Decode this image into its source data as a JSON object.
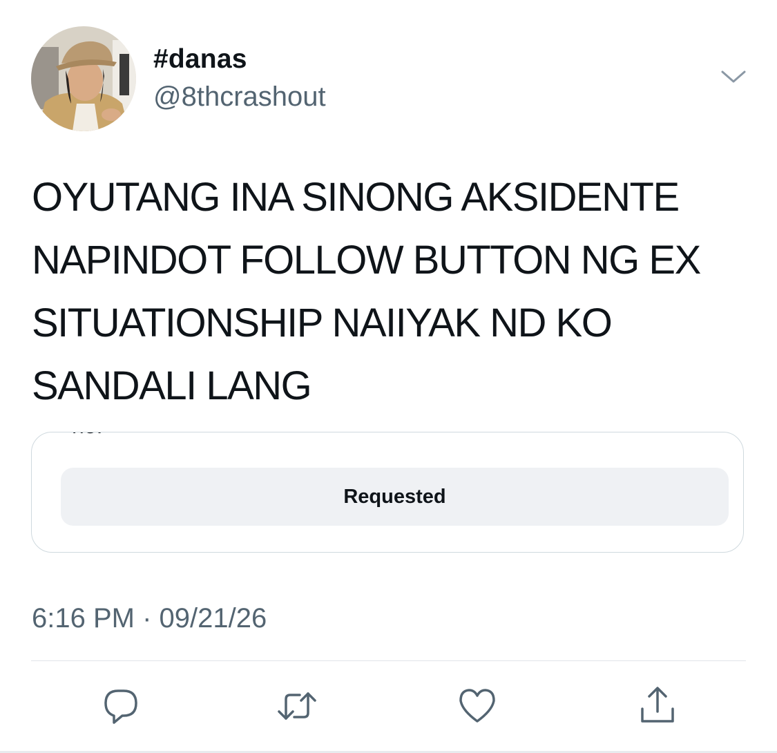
{
  "tweet": {
    "display_name": "#danas",
    "handle": "@8thcrashout",
    "text_lines": [
      "OYUTANG INA SINONG AKSIDENTE",
      "NAPINDOT FOLLOW BUTTON NG EX",
      "SITUATIONSHIP NAIIYAK ND KO",
      "SANDALI LANG"
    ],
    "timestamp": "6:16 PM · 09/21/26"
  },
  "embed": {
    "cropped_text": "no.",
    "button_label": "Requested"
  },
  "icons": {
    "more": "chevron-down-icon",
    "reply": "reply-icon",
    "retweet": "retweet-icon",
    "like": "heart-icon",
    "share": "share-icon"
  },
  "colors": {
    "text": "#0f1419",
    "secondary_text": "#536471",
    "icon": "#536471",
    "card_border": "#cfd9de",
    "button_bg": "#eff1f4"
  }
}
